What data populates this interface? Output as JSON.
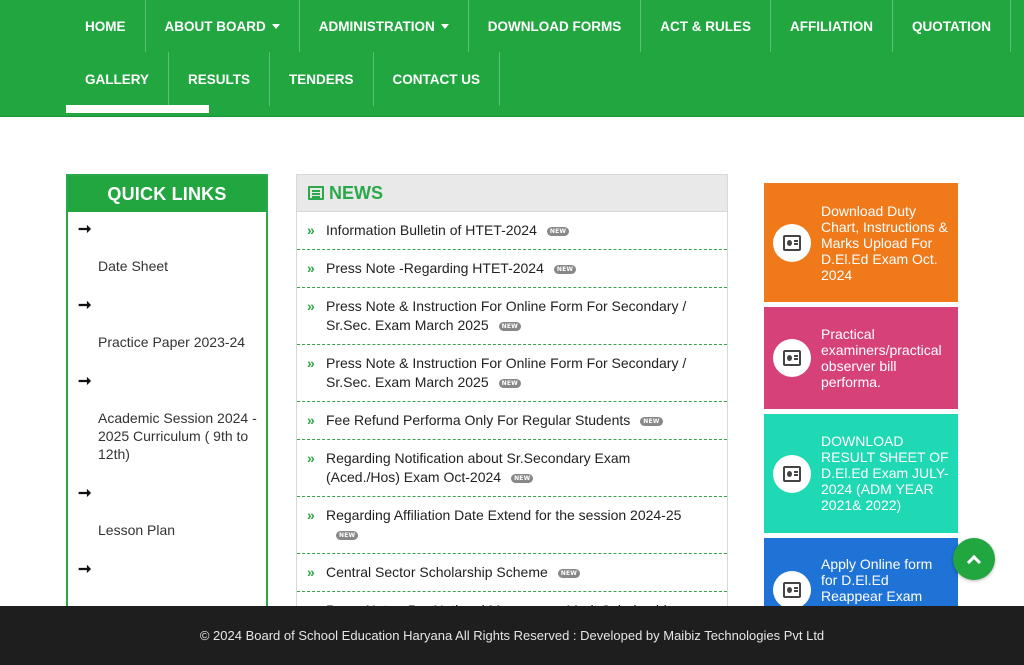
{
  "nav": {
    "row1": [
      {
        "label": "HOME",
        "dropdown": false
      },
      {
        "label": "ABOUT BOARD",
        "dropdown": true
      },
      {
        "label": "ADMINISTRATION",
        "dropdown": true
      },
      {
        "label": "DOWNLOAD FORMS",
        "dropdown": false
      },
      {
        "label": "ACT & RULES",
        "dropdown": false
      },
      {
        "label": "AFFILIATION",
        "dropdown": false
      },
      {
        "label": "QUOTATION",
        "dropdown": false
      }
    ],
    "row2": [
      {
        "label": "GALLERY",
        "dropdown": false
      },
      {
        "label": "RESULTS",
        "dropdown": false
      },
      {
        "label": "TENDERS",
        "dropdown": false
      },
      {
        "label": "CONTACT US",
        "dropdown": false
      }
    ]
  },
  "quick_links": {
    "title": "QUICK LINKS",
    "arrow": "➞",
    "items": [
      {
        "label": "Date Sheet"
      },
      {
        "label": "Practice Paper 2023-24"
      },
      {
        "label": "Academic Session 2024 - 2025 Curriculum ( 9th to 12th)"
      },
      {
        "label": "Lesson Plan"
      },
      {
        "label": ""
      }
    ]
  },
  "news": {
    "title": "NEWS",
    "badge": "NEW",
    "chevron": "»",
    "items": [
      {
        "text": "Information Bulletin of HTET-2024"
      },
      {
        "text": "Press Note -Regarding HTET-2024"
      },
      {
        "text": "Press Note & Instruction For Online Form For Secondary / Sr.Sec. Exam March 2025"
      },
      {
        "text": "Press Note & Instruction For Online Form For Secondary / Sr.Sec. Exam March 2025"
      },
      {
        "text": "Fee Refund Performa Only For Regular Students"
      },
      {
        "text": "Regarding Notification about Sr.Secondary Exam (Aced./Hos) Exam Oct-2024"
      },
      {
        "text": "Regarding Affiliation Date Extend for the session 2024-25"
      },
      {
        "text": "Central Sector Scholarship Scheme"
      },
      {
        "text": "Press Note - Pre National Means-cum-Merit Scholarship"
      }
    ]
  },
  "side_boxes": [
    {
      "text": "Download Duty Chart, Instructions & Marks Upload For D.El.Ed Exam Oct. 2024",
      "color": "#f07a1a"
    },
    {
      "text": "Practical examiners/practical observer bill performa.",
      "color": "#d6417a"
    },
    {
      "text": "DOWNLOAD RESULT SHEET OF D.El.Ed Exam JULY-2024 (ADM YEAR 2021& 2022)",
      "color": "#1fd8b4"
    },
    {
      "text": "Apply Online form for D.El.Ed Reappear Exam",
      "color": "#1f72d6"
    }
  ],
  "footer": {
    "text": "© 2024 Board of School Education Haryana All Rights Reserved : Developed by Maibiz Technologies Pvt Ltd"
  },
  "colors": {
    "brand_green": "#21a640",
    "footer_bg": "#1e1e1e"
  }
}
